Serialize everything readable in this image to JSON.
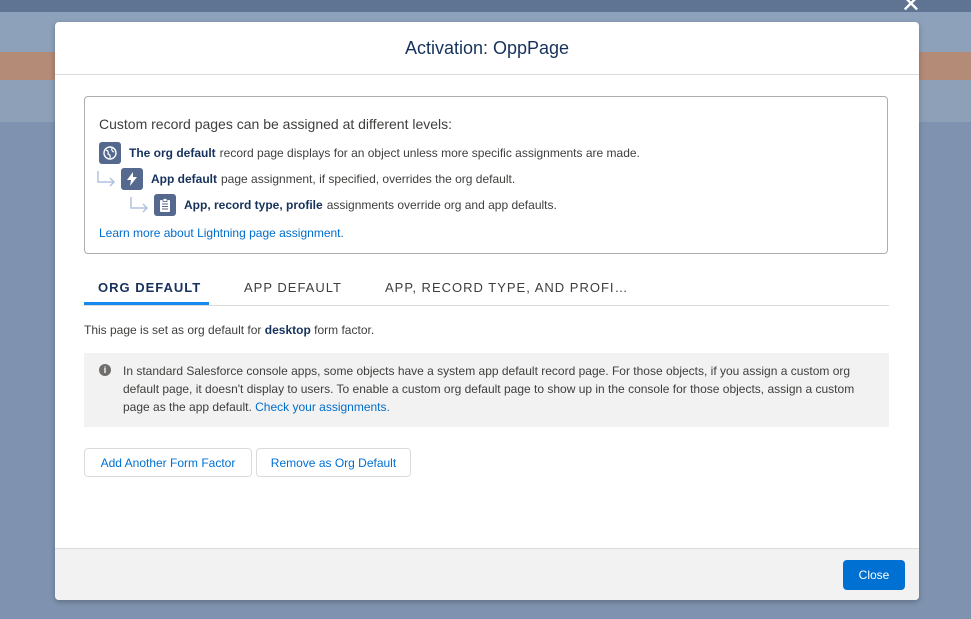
{
  "modal": {
    "title": "Activation: OppPage"
  },
  "info": {
    "heading": "Custom record pages can be assigned at different levels:",
    "levels": [
      {
        "bold": "The org default",
        "text": "record page displays for an object unless more specific assignments are made.",
        "icon": "globe-icon"
      },
      {
        "bold": "App default",
        "text": "page assignment, if specified, overrides the org default.",
        "icon": "lightning-icon"
      },
      {
        "bold": "App, record type, profile",
        "text": "assignments override org and app defaults.",
        "icon": "clipboard-icon"
      }
    ],
    "learn_link": "Learn more about Lightning page assignment."
  },
  "tabs": [
    {
      "label": "ORG DEFAULT",
      "active": true
    },
    {
      "label": "APP DEFAULT",
      "active": false
    },
    {
      "label": "APP, RECORD TYPE, AND PROFI…",
      "active": false
    }
  ],
  "description": {
    "prefix": "This page is set as org default for",
    "bold": "desktop",
    "suffix": "form factor."
  },
  "notice": {
    "text": "In standard Salesforce console apps, some objects have a system app default record page. For those objects, if you assign a custom org default page, it doesn't display to users. To enable a custom org default page to show up in the console for those objects, assign a custom page as the app default.",
    "link": "Check your assignments."
  },
  "buttons": {
    "add_form_factor": "Add Another Form Factor",
    "remove_org_default": "Remove as Org Default"
  },
  "footer": {
    "close": "Close"
  },
  "colors": {
    "brand_blue": "#0070d2",
    "title_navy": "#16325c",
    "icon_slate": "#54698d"
  }
}
